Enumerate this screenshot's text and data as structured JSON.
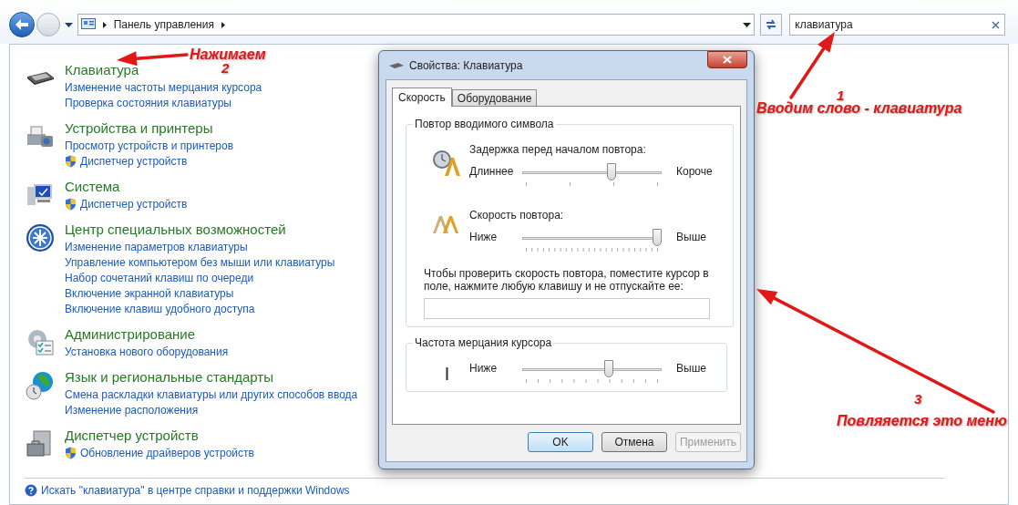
{
  "address_bar": {
    "path": "Панель управления"
  },
  "search": {
    "value": "клавиатура"
  },
  "categories": [
    {
      "title": "Клавиатура",
      "links": [
        {
          "text": "Изменение частоты мерцания курсора",
          "shield": false
        },
        {
          "text": "Проверка состояния клавиатуры",
          "shield": false
        }
      ]
    },
    {
      "title": "Устройства и принтеры",
      "links": [
        {
          "text": "Просмотр устройств и принтеров",
          "shield": false
        },
        {
          "text": "Диспетчер устройств",
          "shield": true
        }
      ]
    },
    {
      "title": "Система",
      "links": [
        {
          "text": "Диспетчер устройств",
          "shield": true
        }
      ]
    },
    {
      "title": "Центр специальных возможностей",
      "links": [
        {
          "text": "Изменение параметров клавиатуры",
          "shield": false
        },
        {
          "text": "Управление компьютером без мыши или клавиатуры",
          "shield": false
        },
        {
          "text": "Набор сочетаний клавиш по очереди",
          "shield": false
        },
        {
          "text": "Включение экранной клавиатуры",
          "shield": false
        },
        {
          "text": "Включение клавиш удобного доступа",
          "shield": false
        }
      ]
    },
    {
      "title": "Администрирование",
      "links": [
        {
          "text": "Установка нового оборудования",
          "shield": false
        }
      ]
    },
    {
      "title": "Язык и региональные стандарты",
      "links": [
        {
          "text": "Смена раскладки клавиатуры или других способов ввода",
          "shield": false
        },
        {
          "text": "Изменение расположения",
          "shield": false
        }
      ]
    },
    {
      "title": "Диспетчер устройств",
      "links": [
        {
          "text": "Обновление драйверов устройств",
          "shield": true
        }
      ]
    }
  ],
  "help_link": "Искать \"клавиатура\" в центре справки и поддержки Windows",
  "dialog": {
    "title": "Свойства: Клавиатура",
    "tabs": [
      {
        "label": "Скорость",
        "selected": true
      },
      {
        "label": "Оборудование",
        "selected": false
      }
    ],
    "groups": [
      {
        "title": "Повтор вводимого символа",
        "sliders": [
          {
            "label": "Задержка перед началом повтора:",
            "min_label": "Длиннее",
            "max_label": "Короче",
            "level": 0.65
          },
          {
            "label": "Скорость повтора:",
            "min_label": "Ниже",
            "max_label": "Выше",
            "level": 1
          }
        ],
        "test_hint": "Чтобы проверить скорость повтора, поместите курсор в поле, нажмите любую клавишу и не отпускайте ее:"
      },
      {
        "title": "Частота мерцания курсора",
        "sliders": [
          {
            "min_label": "Ниже",
            "max_label": "Выше",
            "level": 0.63
          }
        ]
      }
    ],
    "buttons": [
      {
        "label": "OK",
        "disabled": false,
        "default": true
      },
      {
        "label": "Отмена",
        "disabled": false,
        "default": false
      },
      {
        "label": "Применить",
        "disabled": true,
        "default": false
      }
    ]
  },
  "annotations": [
    {
      "number": "1",
      "text": "Вводим слово - клавиатура"
    },
    {
      "number": "2",
      "text": "Нажимаем"
    },
    {
      "number": "3",
      "text": "Повляяется это меню"
    }
  ]
}
